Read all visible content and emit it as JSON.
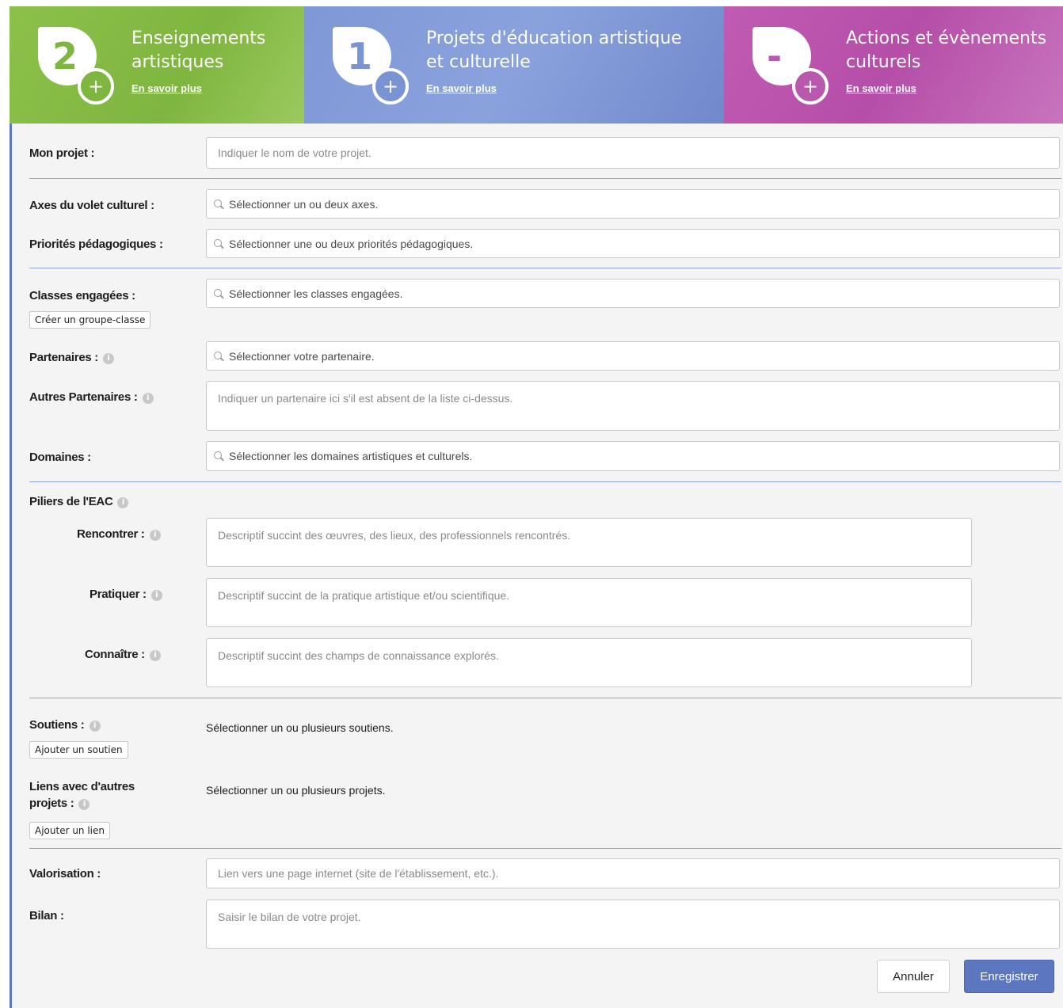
{
  "header": {
    "tiles": [
      {
        "digit": "2",
        "title_line1": "Enseignements",
        "title_line2": "artistiques",
        "more": "En savoir plus"
      },
      {
        "digit": "1",
        "title_line1": "Projets d'éducation artistique",
        "title_line2": "et culturelle",
        "more": "En savoir plus"
      },
      {
        "digit": "-",
        "title_line1": "Actions et évènements",
        "title_line2": "culturels",
        "more": "En savoir plus"
      }
    ],
    "colors": {
      "green": "#7fb63f",
      "blue": "#7a93d3",
      "purple": "#b859ad"
    }
  },
  "form": {
    "mon_projet": {
      "label": "Mon projet :",
      "placeholder": "Indiquer le nom de votre projet."
    },
    "axes": {
      "label": "Axes du volet culturel :",
      "placeholder": "Sélectionner un ou deux axes."
    },
    "priorites": {
      "label": "Priorités pédagogiques :",
      "placeholder": "Sélectionner une ou deux priorités pédagogiques."
    },
    "classes": {
      "label": "Classes engagées :",
      "placeholder": "Sélectionner les classes engagées.",
      "button": "Créer un groupe-classe"
    },
    "partenaires": {
      "label": "Partenaires :",
      "placeholder": "Sélectionner votre partenaire."
    },
    "autres_partenaires": {
      "label": "Autres Partenaires :",
      "placeholder": "Indiquer un partenaire ici s'il est absent de la liste ci-dessus."
    },
    "domaines": {
      "label": "Domaines :",
      "placeholder": "Sélectionner les domaines artistiques et culturels."
    },
    "piliers": {
      "label": "Piliers de l'EAC",
      "rencontrer": {
        "label": "Rencontrer :",
        "placeholder": "Descriptif succint des œuvres, des lieux, des professionnels rencontrés."
      },
      "pratiquer": {
        "label": "Pratiquer :",
        "placeholder": "Descriptif succint de la pratique artistique et/ou scientifique."
      },
      "connaitre": {
        "label": "Connaître :",
        "placeholder": "Descriptif succint des champs de connaissance explorés."
      }
    },
    "soutiens": {
      "label": "Soutiens :",
      "text": "Sélectionner un ou plusieurs soutiens.",
      "button": "Ajouter un soutien"
    },
    "liens": {
      "label_line1": "Liens avec d'autres",
      "label_line2": "projets :",
      "text": "Sélectionner un ou plusieurs projets.",
      "button": "Ajouter un lien"
    },
    "valorisation": {
      "label": "Valorisation :",
      "placeholder": "Lien vers une page internet (site de l'établissement, etc.)."
    },
    "bilan": {
      "label": "Bilan :",
      "placeholder": "Saisir le bilan de votre projet."
    },
    "actions": {
      "cancel": "Annuler",
      "save": "Enregistrer"
    }
  }
}
